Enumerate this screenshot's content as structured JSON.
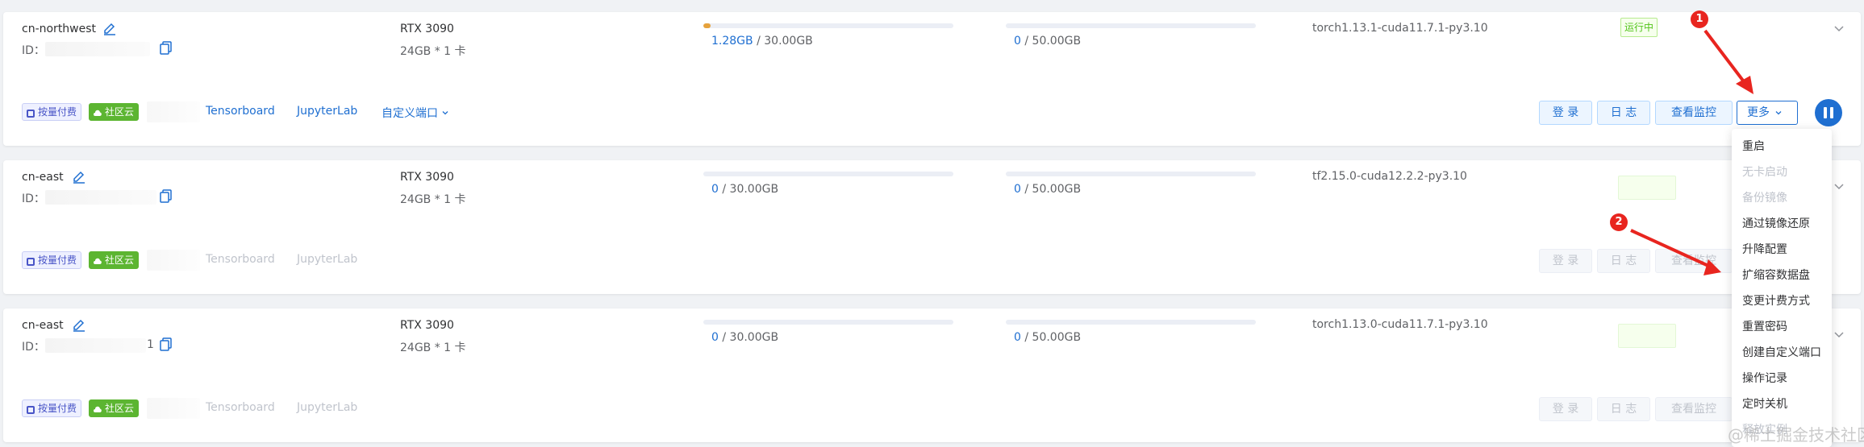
{
  "instances": [
    {
      "region": "cn-northwest",
      "id_label": "ID：",
      "gpu_name": "RTX 3090",
      "gpu_spec": "24GB * 1 卡",
      "system_disk": {
        "used": "1.28GB",
        "sep": " / ",
        "total": "30.00GB",
        "fill_fraction": 0.03
      },
      "data_disk": {
        "used": "0",
        "sep": " / ",
        "total": "50.00GB",
        "fill_fraction": 0
      },
      "image": "torch1.13.1-cuda11.7.1-py3.10",
      "status": "运行中",
      "tags": {
        "billing": "按量付费",
        "cloud": "社区云"
      },
      "links": [
        "Tensorboard",
        "JupyterLab",
        "自定义端口"
      ],
      "buttons": [
        "登 录",
        "日 志",
        "查看监控",
        "更多"
      ]
    },
    {
      "region": "cn-east",
      "id_label": "ID：",
      "gpu_name": "RTX 3090",
      "gpu_spec": "24GB * 1 卡",
      "system_disk": {
        "used": "0",
        "sep": " / ",
        "total": "30.00GB",
        "fill_fraction": 0
      },
      "data_disk": {
        "used": "0",
        "sep": " / ",
        "total": "50.00GB",
        "fill_fraction": 0
      },
      "image": "tf2.15.0-cuda12.2.2-py3.10",
      "tags": {
        "billing": "按量付费",
        "cloud": "社区云"
      },
      "links": [
        "Tensorboard",
        "JupyterLab"
      ],
      "buttons": [
        "登 录",
        "日 志",
        "查看监控"
      ]
    },
    {
      "region": "cn-east",
      "id_label": "ID：",
      "id_tail": "1",
      "gpu_name": "RTX 3090",
      "gpu_spec": "24GB * 1 卡",
      "system_disk": {
        "used": "0",
        "sep": " / ",
        "total": "30.00GB",
        "fill_fraction": 0
      },
      "data_disk": {
        "used": "0",
        "sep": " / ",
        "total": "50.00GB",
        "fill_fraction": 0
      },
      "image": "torch1.13.0-cuda11.7.1-py3.10",
      "tags": {
        "billing": "按量付费",
        "cloud": "社区云"
      },
      "links": [
        "Tensorboard",
        "JupyterLab"
      ],
      "buttons": [
        "登 录",
        "日 志",
        "查看监控"
      ]
    }
  ],
  "more_menu": [
    {
      "label": "重启",
      "disabled": false
    },
    {
      "label": "无卡启动",
      "disabled": true
    },
    {
      "label": "备份镜像",
      "disabled": true
    },
    {
      "label": "通过镜像还原",
      "disabled": false
    },
    {
      "label": "升降配置",
      "disabled": false
    },
    {
      "label": "扩缩容数据盘",
      "disabled": false
    },
    {
      "label": "变更计费方式",
      "disabled": false
    },
    {
      "label": "重置密码",
      "disabled": false
    },
    {
      "label": "创建自定义端口",
      "disabled": false
    },
    {
      "label": "操作记录",
      "disabled": false
    },
    {
      "label": "定时关机",
      "disabled": false
    },
    {
      "label": "释放实例",
      "disabled": true
    }
  ],
  "annotations": {
    "marker1": "1",
    "marker2": "2"
  },
  "watermark": "@稀土掘金技术社区",
  "colors": {
    "accent": "#1f6fd1",
    "progress": "#e6a23c",
    "running": "#52c41a",
    "community_tag": "#5cb531",
    "annotation": "#e8251f"
  }
}
